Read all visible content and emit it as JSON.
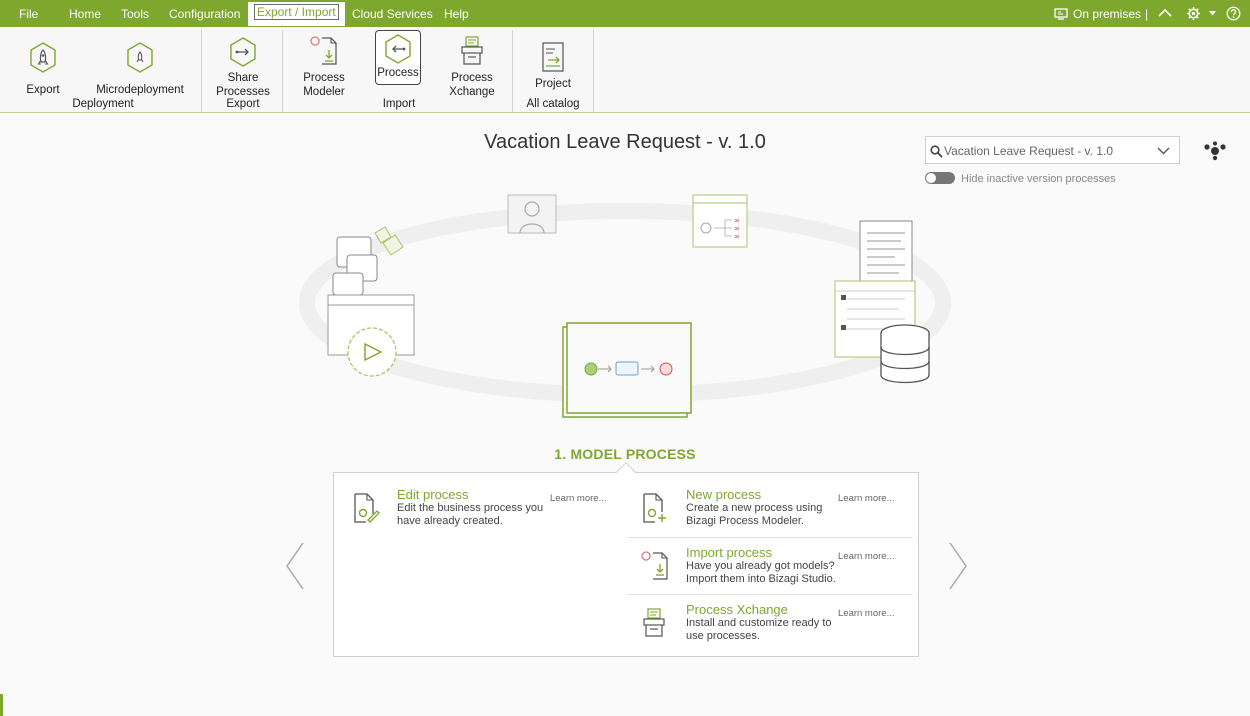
{
  "menu": {
    "items": [
      "File",
      "Home",
      "Tools",
      "Configuration",
      "Export / Import",
      "Cloud Services",
      "Help"
    ],
    "right": {
      "env_label": "On premises",
      "separator": "|"
    }
  },
  "ribbon": {
    "export": "Export",
    "microdeployment": "Microdeployment",
    "group_deployment": "Deployment",
    "share_line1": "Share",
    "share_line2": "Processes",
    "group_export": "Export",
    "process_modeler_line1": "Process",
    "process_modeler_line2": "Modeler",
    "process": "Process",
    "process_xchange_line1": "Process",
    "process_xchange_line2": "Xchange",
    "group_import": "Import",
    "project": "Project",
    "group_all_catalog": "All catalog"
  },
  "main": {
    "title": "Vacation Leave Request - v. 1.0",
    "search_value": "Vacation Leave Request - v. 1.0",
    "toggle_label": "Hide inactive version processes",
    "step_label": "1. MODEL PROCESS"
  },
  "cards": {
    "edit": {
      "title": "Edit process",
      "desc1": "Edit the business process you",
      "desc2": "have already created.",
      "learn": "Learn more..."
    },
    "new": {
      "title": "New process",
      "desc1": "Create a new process using",
      "desc2": "Bizagi Process Modeler.",
      "learn": "Learn more..."
    },
    "import": {
      "title": "Import process",
      "desc1": "Have you already got models?",
      "desc2": "Import them into Bizagi Studio.",
      "learn": "Learn more..."
    },
    "xchange": {
      "title": "Process Xchange",
      "desc1": "Install and customize ready to",
      "desc2": "use processes.",
      "learn": "Learn more..."
    }
  },
  "colors": {
    "accent": "#7ea72e",
    "menubar": "#7ea72e",
    "start_event": "#a9cf7a",
    "end_event": "#e0787b",
    "task": "#6aa0cf"
  },
  "icons": [
    "rocket-icon",
    "gear-icon",
    "share-icon",
    "modeler-icon",
    "process-hexagon-icon",
    "xchange-icon",
    "project-icon",
    "search-icon",
    "chevron-down-icon",
    "help-icon",
    "network-icon"
  ]
}
